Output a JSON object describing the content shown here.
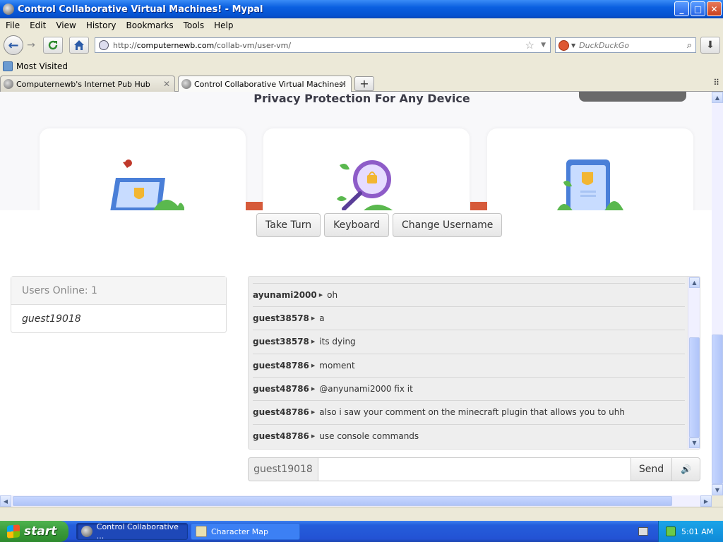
{
  "window": {
    "title": "Control Collaborative Virtual Machines! - Mypal",
    "minimize": "_",
    "maximize": "□",
    "close": "✕"
  },
  "menu": [
    "File",
    "Edit",
    "View",
    "History",
    "Bookmarks",
    "Tools",
    "Help"
  ],
  "nav": {
    "url_scheme": "http://",
    "url_domain": "computernewb.com",
    "url_path": "/collab-vm/user-vm/",
    "search_placeholder": "DuckDuckGo"
  },
  "bookmarks": {
    "most_visited": "Most Visited"
  },
  "tabs": [
    {
      "label": "Computernewb's Internet Pub Hub"
    },
    {
      "label": "Control Collaborative Virtual Machines!"
    }
  ],
  "vm": {
    "screen_heading": "Privacy Protection For Any Device",
    "buttons": {
      "take_turn": "Take Turn",
      "keyboard": "Keyboard",
      "change_username": "Change Username"
    }
  },
  "users_panel": {
    "heading": "Users Online: 1",
    "users": [
      "guest19018"
    ]
  },
  "chat": {
    "messages": [
      {
        "user": "ayunami2000",
        "text": "oh"
      },
      {
        "user": "guest38578",
        "text": "a"
      },
      {
        "user": "guest38578",
        "text": "its dying"
      },
      {
        "user": "guest48786",
        "text": "moment"
      },
      {
        "user": "guest48786",
        "text": "@anyunami2000 fix it"
      },
      {
        "user": "guest48786",
        "text": "also i saw your comment on the minecraft plugin that allows you to uhh"
      },
      {
        "user": "guest48786",
        "text": "use console commands"
      }
    ],
    "username": "guest19018",
    "input_value": "",
    "send_label": "Send",
    "volume_icon": "🔊"
  },
  "taskbar": {
    "start_label": "start",
    "tasks": [
      "Control Collaborative ...",
      "Character Map"
    ],
    "clock": "5:01 AM"
  }
}
